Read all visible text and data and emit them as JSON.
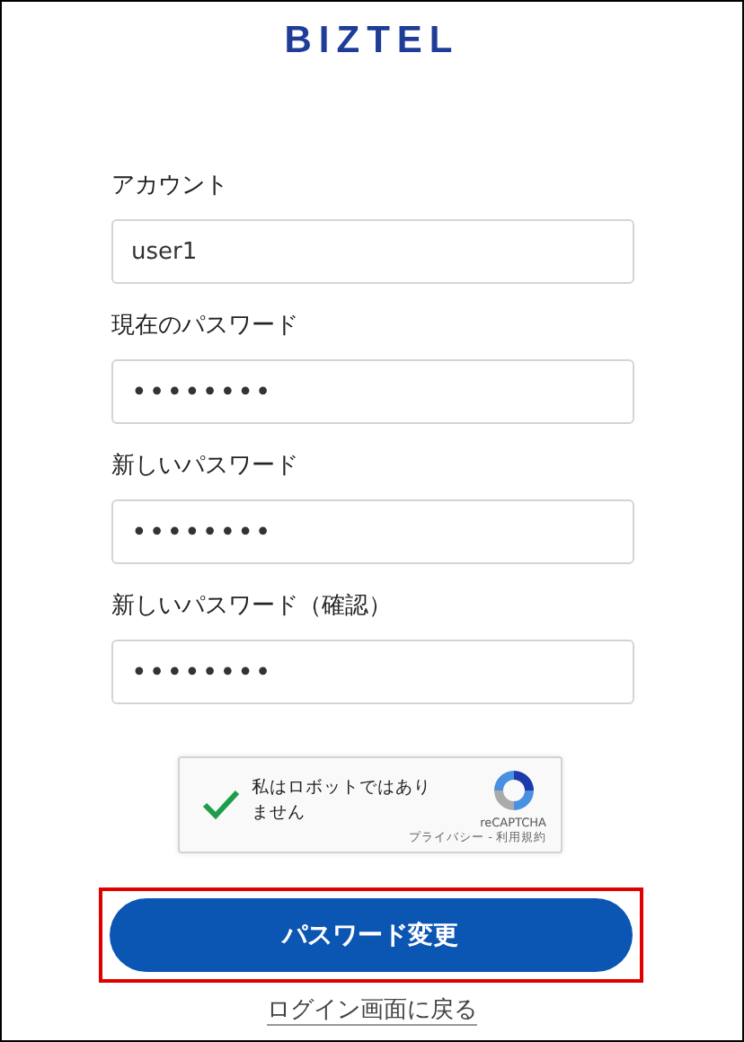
{
  "logo": "BIZTEL",
  "fields": [
    {
      "label": "アカウント",
      "value": "user1",
      "kind": "text"
    },
    {
      "label": "現在のパスワード",
      "value": "••••••••",
      "kind": "password"
    },
    {
      "label": "新しいパスワード",
      "value": "••••••••",
      "kind": "password"
    },
    {
      "label": "新しいパスワード（確認）",
      "value": "••••••••",
      "kind": "password"
    }
  ],
  "captcha": {
    "checked": true,
    "label": "私はロボットではありません",
    "brand": "reCAPTCHA",
    "links": "プライバシー - 利用規約"
  },
  "submit": {
    "label": "パスワード変更",
    "highlighted": true
  },
  "back_link": "ログイン画面に戻る"
}
